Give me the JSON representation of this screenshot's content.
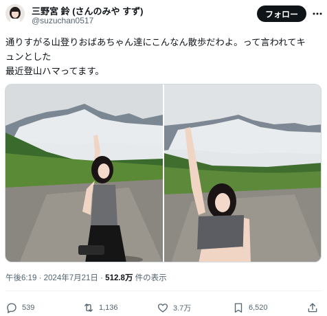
{
  "author": {
    "display_name": "三野宮 鈴 (さんのみや すず)",
    "handle": "@suzuchan0517"
  },
  "follow_label": "フォロー",
  "text_lines": [
    "通りすがる山登りおばあちゃん達にこんなん散歩だわよ。って言われてキ",
    "ュンとした",
    "最近登山ハマってます。"
  ],
  "meta": {
    "time": "午後6:19",
    "sep": "·",
    "date": "2024年7月21日",
    "views": "512.8万",
    "views_suffix": "件の表示"
  },
  "actions": {
    "replies": "539",
    "reposts": "1,136",
    "likes": "3.7万",
    "bookmarks": "6,520"
  },
  "icons": [
    "more-icon",
    "reply-icon",
    "repost-icon",
    "like-icon",
    "bookmark-icon",
    "share-icon"
  ],
  "colors": {
    "button_bg": "#0f1419",
    "secondary_text": "#536471"
  }
}
